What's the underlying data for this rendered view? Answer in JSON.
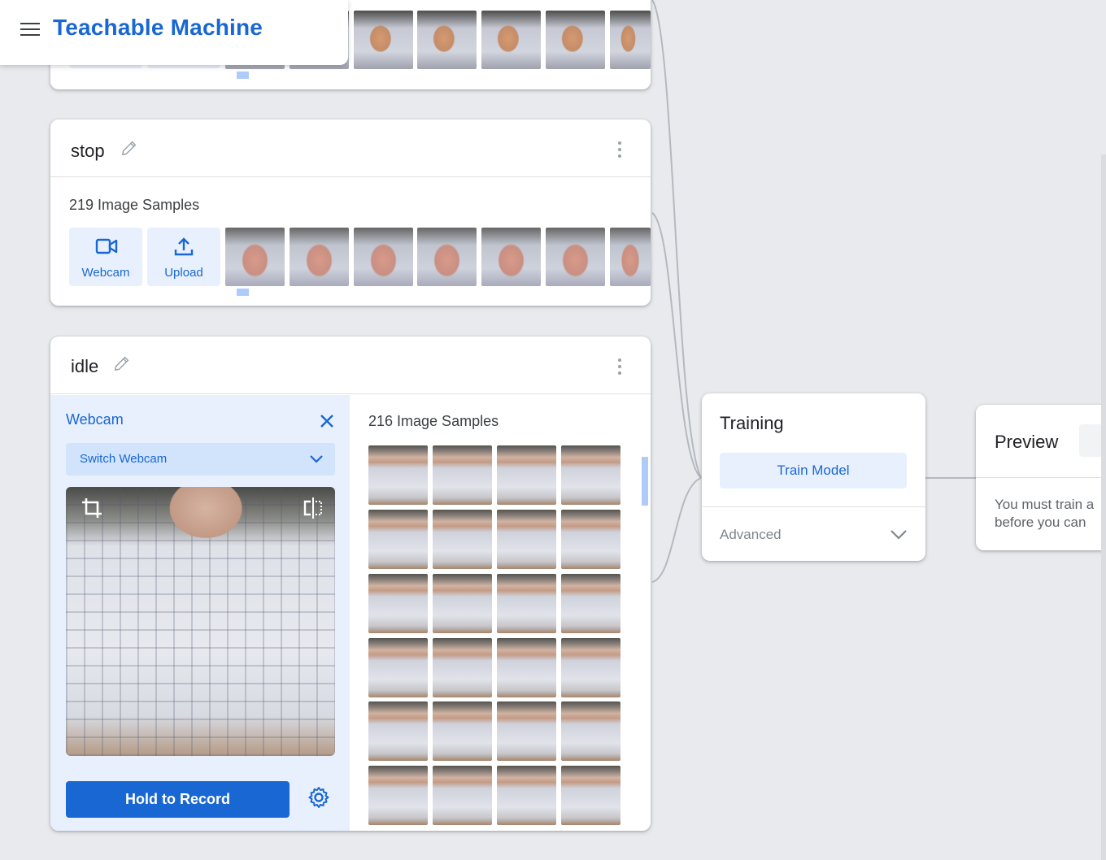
{
  "app": {
    "title": "Teachable Machine"
  },
  "icons": {
    "menu": "hamburger-icon",
    "edit": "pencil-icon",
    "more": "kebab-icon",
    "webcam": "video-camera-icon",
    "upload": "upload-icon",
    "close": "close-icon",
    "crop": "crop-icon",
    "flip": "flip-icon",
    "settings": "gear-icon",
    "chevron": "chevron-down-icon"
  },
  "colors": {
    "accent": "#1967d2",
    "accent_light": "#e8f0fe",
    "background": "#e8eaed"
  },
  "classes": [
    {
      "name": "stop",
      "sample_count": "219 Image Samples",
      "webcam_label": "Webcam",
      "upload_label": "Upload"
    },
    {
      "name": "idle",
      "sample_count": "216 Image Samples"
    }
  ],
  "webcam_panel": {
    "label": "Webcam",
    "switch_webcam": "Switch Webcam",
    "record_label": "Hold to Record"
  },
  "training": {
    "title": "Training",
    "train_button": "Train Model",
    "advanced_label": "Advanced"
  },
  "preview": {
    "title": "Preview",
    "message_line1": "You must train a",
    "message_line2": "before you can"
  }
}
